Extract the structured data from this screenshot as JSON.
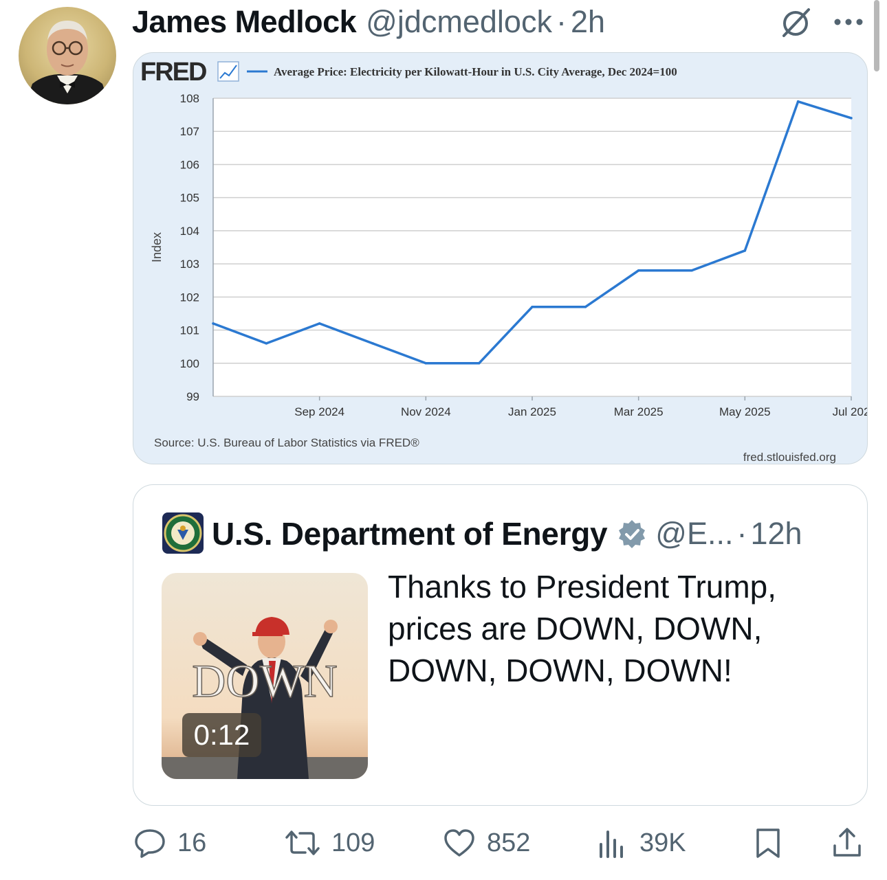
{
  "tweet": {
    "author_name": "James Medlock",
    "author_handle": "@jdcmedlock",
    "separator": "·",
    "time": "2h"
  },
  "chart": {
    "brand": "FRED",
    "legend": "Average Price: Electricity per Kilowatt-Hour in U.S. City Average, Dec 2024=100",
    "source": "Source: U.S. Bureau of Labor Statistics via FRED®",
    "url": "fred.stlouisfed.org",
    "line_color": "#2b79d1"
  },
  "chart_data": {
    "type": "line",
    "ylabel": "Index",
    "ylim": [
      99,
      108
    ],
    "y_ticks": [
      99,
      100,
      101,
      102,
      103,
      104,
      105,
      106,
      107,
      108
    ],
    "x_tick_labels": [
      "Sep 2024",
      "Nov 2024",
      "Jan 2025",
      "Mar 2025",
      "May 2025",
      "Jul 202"
    ],
    "x": [
      "2024-07",
      "2024-08",
      "2024-09",
      "2024-10",
      "2024-11",
      "2024-12",
      "2025-01",
      "2025-02",
      "2025-03",
      "2025-04",
      "2025-05",
      "2025-06",
      "2025-07"
    ],
    "series": [
      {
        "values": [
          101.2,
          100.6,
          101.2,
          100.6,
          100.0,
          100.0,
          101.7,
          101.7,
          102.8,
          102.8,
          103.4,
          107.9,
          107.4
        ]
      }
    ],
    "grid": true
  },
  "quote": {
    "name": "U.S. Department of Energy",
    "handle": "@E...",
    "separator": "·",
    "time": "12h",
    "text": "Thanks to President Trump, prices are DOWN, DOWN, DOWN, DOWN, DOWN!",
    "video_caption": "DOWN",
    "video_duration": "0:12"
  },
  "actions": {
    "replies": "16",
    "reposts": "109",
    "likes": "852",
    "views": "39K"
  },
  "icons": [
    "grok-icon",
    "more-icon",
    "verified-badge-icon",
    "reply-icon",
    "repost-icon",
    "like-icon",
    "views-icon",
    "bookmark-icon",
    "share-icon"
  ]
}
